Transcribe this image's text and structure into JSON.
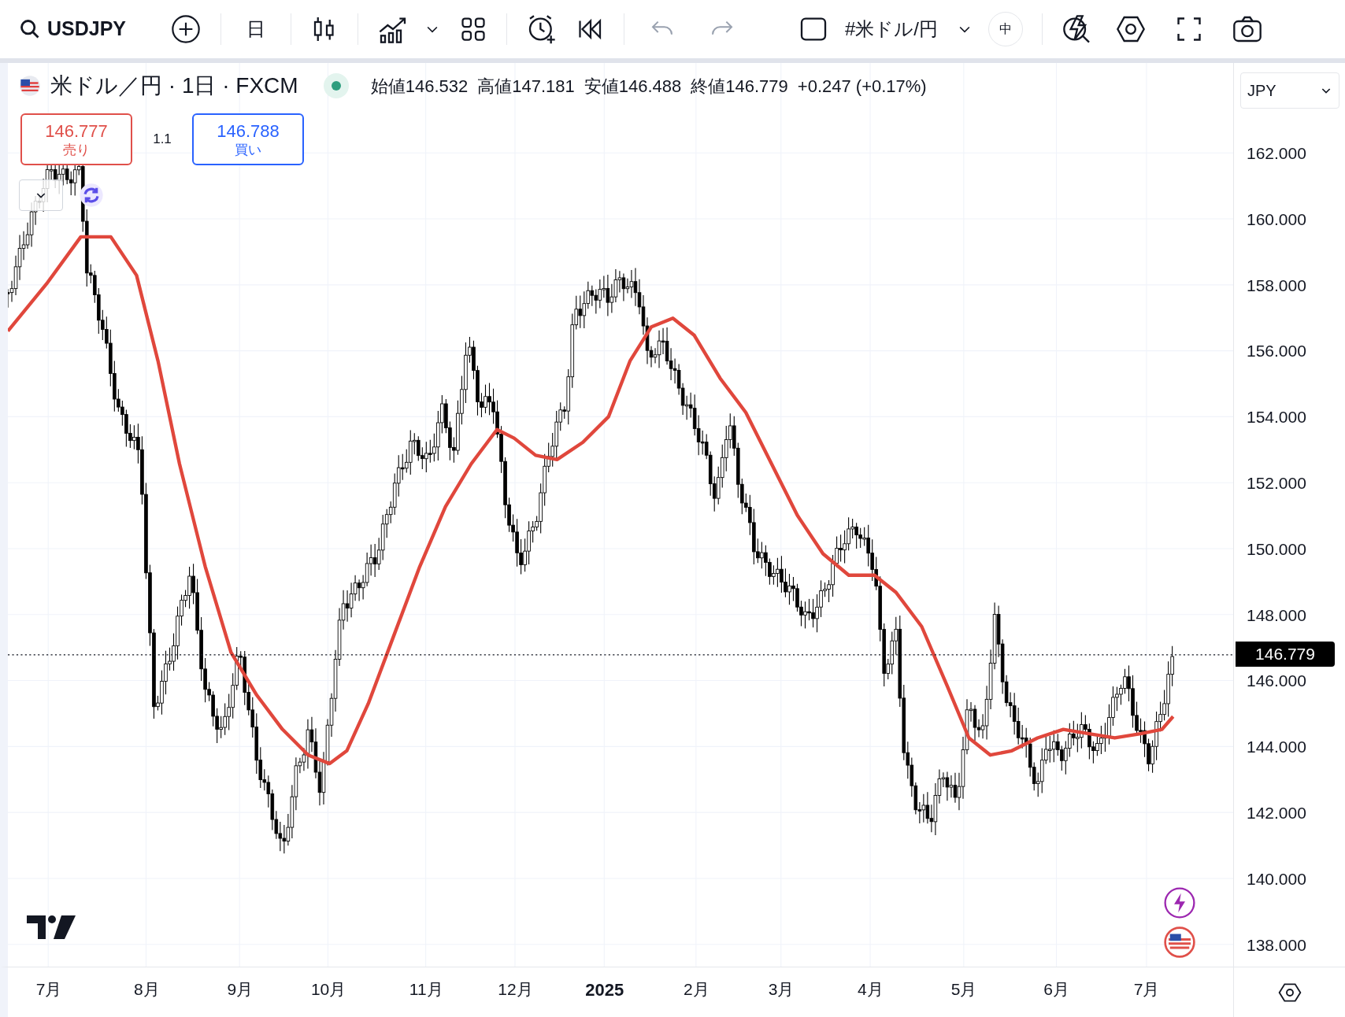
{
  "toolbar": {
    "symbol": "USDJPY",
    "interval": "日",
    "symbol_search": "#米ドル/円",
    "language_badge": "中"
  },
  "legend": {
    "title": "米ドル／円 · 1日 · FXCM",
    "market_open": true,
    "values": [
      {
        "label": "始値",
        "value": "146.532"
      },
      {
        "label": "高値",
        "value": "147.181"
      },
      {
        "label": "安値",
        "value": "146.488"
      },
      {
        "label": "終値",
        "value": "146.779"
      }
    ],
    "change": "+0.247 (+0.17%)"
  },
  "trade": {
    "sell": {
      "price": "146.777",
      "label": "売り"
    },
    "spread": "1.1",
    "buy": {
      "price": "146.788",
      "label": "買い"
    }
  },
  "currency": "JPY",
  "price_axis": [
    "162.000",
    "160.000",
    "158.000",
    "156.000",
    "154.000",
    "152.000",
    "150.000",
    "148.000",
    "146.000",
    "144.000",
    "142.000",
    "140.000",
    "138.000"
  ],
  "last_price": "146.779",
  "time_axis": [
    {
      "label": "7月",
      "kind": "month"
    },
    {
      "label": "8月",
      "kind": "month"
    },
    {
      "label": "9月",
      "kind": "month"
    },
    {
      "label": "10月",
      "kind": "month"
    },
    {
      "label": "11月",
      "kind": "month"
    },
    {
      "label": "12月",
      "kind": "month"
    },
    {
      "label": "2025",
      "kind": "year"
    },
    {
      "label": "2月",
      "kind": "month"
    },
    {
      "label": "3月",
      "kind": "month"
    },
    {
      "label": "4月",
      "kind": "month"
    },
    {
      "label": "5月",
      "kind": "month"
    },
    {
      "label": "6月",
      "kind": "month"
    },
    {
      "label": "7月",
      "kind": "month"
    }
  ]
}
